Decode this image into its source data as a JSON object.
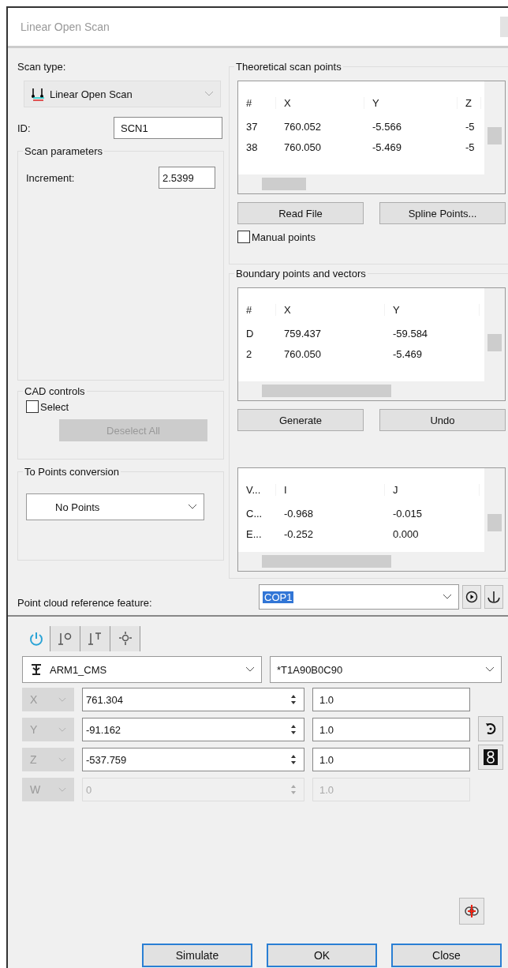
{
  "window": {
    "title": "Linear Open Scan"
  },
  "scan_type": {
    "label": "Scan type:",
    "value": "Linear Open Scan"
  },
  "id": {
    "label": "ID:",
    "value": "SCN1"
  },
  "scan_parameters": {
    "title": "Scan parameters",
    "increment_label": "Increment:",
    "increment_value": "2.5399"
  },
  "cad_controls": {
    "title": "CAD controls",
    "select": {
      "label": "Select",
      "checked": false
    },
    "deselect_all": {
      "label": "Deselect All",
      "disabled": true
    }
  },
  "to_points_conversion": {
    "title": "To Points conversion",
    "value": "No Points"
  },
  "theoretical_scan_points": {
    "title": "Theoretical scan points",
    "grid": {
      "columns": [
        "#",
        "X",
        "Y",
        "Z"
      ],
      "rows": [
        [
          "37",
          "760.052",
          "-5.566",
          "-5"
        ],
        [
          "38",
          "760.050",
          "-5.469",
          "-5"
        ]
      ]
    },
    "buttons": [
      "Read File",
      "Spline Points..."
    ],
    "manual_points": {
      "label": "Manual points",
      "checked": false
    }
  },
  "boundary_points": {
    "title": "Boundary points and vectors",
    "grid": {
      "columns": [
        "#",
        "X",
        "Y"
      ],
      "rows": [
        [
          "D",
          "759.437",
          "-59.584"
        ],
        [
          "2",
          "760.050",
          "-5.469"
        ]
      ]
    },
    "buttons": [
      "Generate",
      "Undo"
    ],
    "vectors_grid": {
      "columns": [
        "V...",
        "I",
        "J"
      ],
      "rows": [
        [
          "C...",
          "-0.968",
          "-0.015"
        ],
        [
          "E...",
          "-0.252",
          "0.000"
        ]
      ]
    }
  },
  "point_cloud_reference": {
    "label": "Point cloud reference feature:",
    "value": "COP1"
  },
  "tabs": [
    {
      "kind": "power",
      "selected": true
    },
    {
      "kind": "probe-gear",
      "selected": false
    },
    {
      "kind": "probe-t",
      "selected": false
    },
    {
      "kind": "move",
      "selected": false
    }
  ],
  "arm": {
    "value": "ARM1_CMS",
    "tip": "*T1A90B0C90"
  },
  "axes": [
    {
      "axis": "X",
      "value": "761.304",
      "weight": "1.0",
      "disabled": false
    },
    {
      "axis": "Y",
      "value": "-91.162",
      "weight": "1.0",
      "disabled": false
    },
    {
      "axis": "Z",
      "value": "-537.759",
      "weight": "1.0",
      "disabled": false
    },
    {
      "axis": "W",
      "value": "0",
      "weight": "1.0",
      "disabled": true
    }
  ],
  "buttons": [
    "Simulate",
    "OK",
    "Close"
  ]
}
